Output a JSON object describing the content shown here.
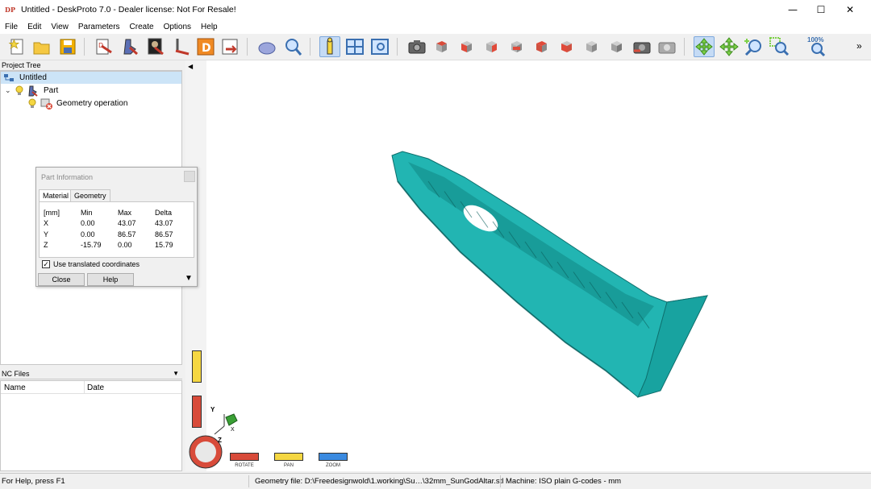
{
  "window": {
    "app_icon": "DP",
    "title": "Untitled - DeskProto 7.0 - Dealer license: Not For Resale!",
    "minimize": "—",
    "maximize": "☐",
    "close": "✕"
  },
  "menu": [
    "File",
    "Edit",
    "View",
    "Parameters",
    "Create",
    "Options",
    "Help"
  ],
  "toolbar": {
    "zoom_label": "100%",
    "overflow": "»",
    "icons": [
      "new-icon",
      "open-icon",
      "save-icon",
      "wizard-icon",
      "tool-path-icon",
      "part-icon",
      "bitmap-icon",
      "vector-icon",
      "drawing-icon",
      "export-icon",
      "sim-icon",
      "info-icon",
      "layout-icon",
      "view-icon",
      "camera-icon",
      "view-cube-icons",
      "rotate-view-icon",
      "pan-view-icon",
      "zoom-in-icon",
      "zoom-window-icon",
      "zoom-100-icon"
    ]
  },
  "project_tree": {
    "header": "Project Tree",
    "items": [
      {
        "label": "Untitled",
        "level": 0
      },
      {
        "label": "Part",
        "level": 1
      },
      {
        "label": "Geometry operation",
        "level": 2
      }
    ]
  },
  "nc_files": {
    "header": "NC Files",
    "columns": [
      "Name",
      "Date"
    ]
  },
  "dialog": {
    "title": "Part Information",
    "tabs": [
      "Material",
      "Geometry"
    ],
    "table": {
      "headers": [
        "[mm]",
        "Min",
        "Max",
        "Delta"
      ],
      "rows": [
        [
          "X",
          "0.00",
          "43.07",
          "43.07"
        ],
        [
          "Y",
          "0.00",
          "86.57",
          "86.57"
        ],
        [
          "Z",
          "-15.79",
          "0.00",
          "15.79"
        ]
      ]
    },
    "checkbox_label": "Use translated coordinates",
    "checkbox_checked": true,
    "close_label": "Close",
    "help_label": "Help"
  },
  "viewport": {
    "model_color": "#22b5b2",
    "axes": {
      "y": "Y",
      "z": "Z",
      "x": "X"
    },
    "controls": [
      "ROTATE",
      "PAN",
      "ZOOM"
    ]
  },
  "status": {
    "help": "For Help, press F1",
    "geometry": "Geometry file: D:\\Freedesignwold\\1.working\\Su…\\32mm_SunGodAltar.stl",
    "machine": "Machine: ISO plain G-codes - mm"
  }
}
